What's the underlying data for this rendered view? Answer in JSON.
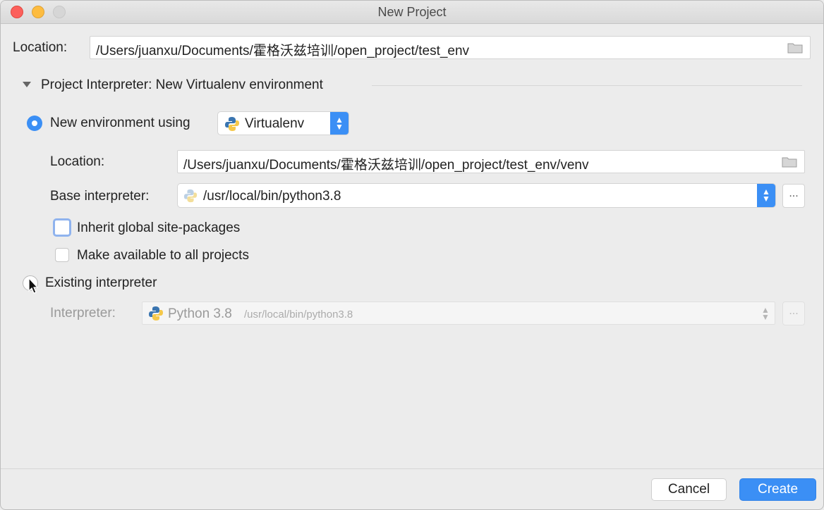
{
  "window": {
    "title": "New Project"
  },
  "location": {
    "label": "Location:",
    "value": "/Users/juanxu/Documents/霍格沃兹培训/open_project/test_env"
  },
  "interpreter_section": {
    "header": "Project Interpreter: New Virtualenv environment"
  },
  "new_env": {
    "radio_label": "New environment using",
    "tool_selected": "Virtualenv",
    "location_label": "Location:",
    "location_value": "/Users/juanxu/Documents/霍格沃兹培训/open_project/test_env/venv",
    "base_label": "Base interpreter:",
    "base_value": "/usr/local/bin/python3.8",
    "inherit_label": "Inherit global site-packages",
    "make_available_label": "Make available to all projects"
  },
  "existing": {
    "radio_label": "Existing interpreter",
    "interpreter_label": "Interpreter:",
    "interpreter_name": "Python 3.8",
    "interpreter_path": "/usr/local/bin/python3.8"
  },
  "buttons": {
    "ellipsis": "...",
    "cancel": "Cancel",
    "create": "Create"
  },
  "icons": {
    "folder": "folder-icon",
    "python": "python-icon",
    "disclosure": "triangle-down-icon",
    "stepper": "up-down-chevron-icon"
  },
  "colors": {
    "accent": "#3b8ff5",
    "window_bg": "#ececec"
  }
}
